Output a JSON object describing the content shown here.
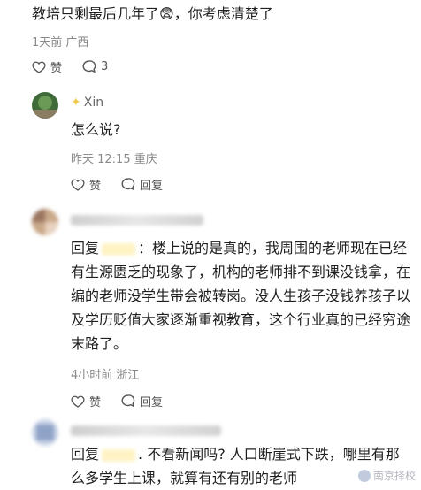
{
  "top_comment": {
    "text_part1": "教培只剩最后几年了",
    "emoji": "😨",
    "text_part2": "，你考虑清楚了",
    "time_location": "1天前 广西",
    "like_label": "赞",
    "reply_count": "3"
  },
  "replies": [
    {
      "username": "Xin",
      "text": "怎么说?",
      "time_location": "昨天 12:15 重庆",
      "like_label": "赞",
      "reply_label": "回复"
    },
    {
      "prefix": "回复",
      "text": "：楼上说的是真的，我周围的老师现在已经有生源匮乏的现象了，机构的老师排不到课没钱拿，在编的老师没学生带会被转岗。没人生孩子没钱养孩子以及学历贬值大家逐渐重视教育，这个行业真的已经穷途末路了。",
      "time_location": "4小时前 浙江",
      "like_label": "赞",
      "reply_label": "回复"
    },
    {
      "prefix": "回复",
      "text": ". 不看新闻吗? 人口断崖式下跌，哪里有那么多学生上课，就算有还有别的老师"
    }
  ],
  "watermark": "南京择校"
}
